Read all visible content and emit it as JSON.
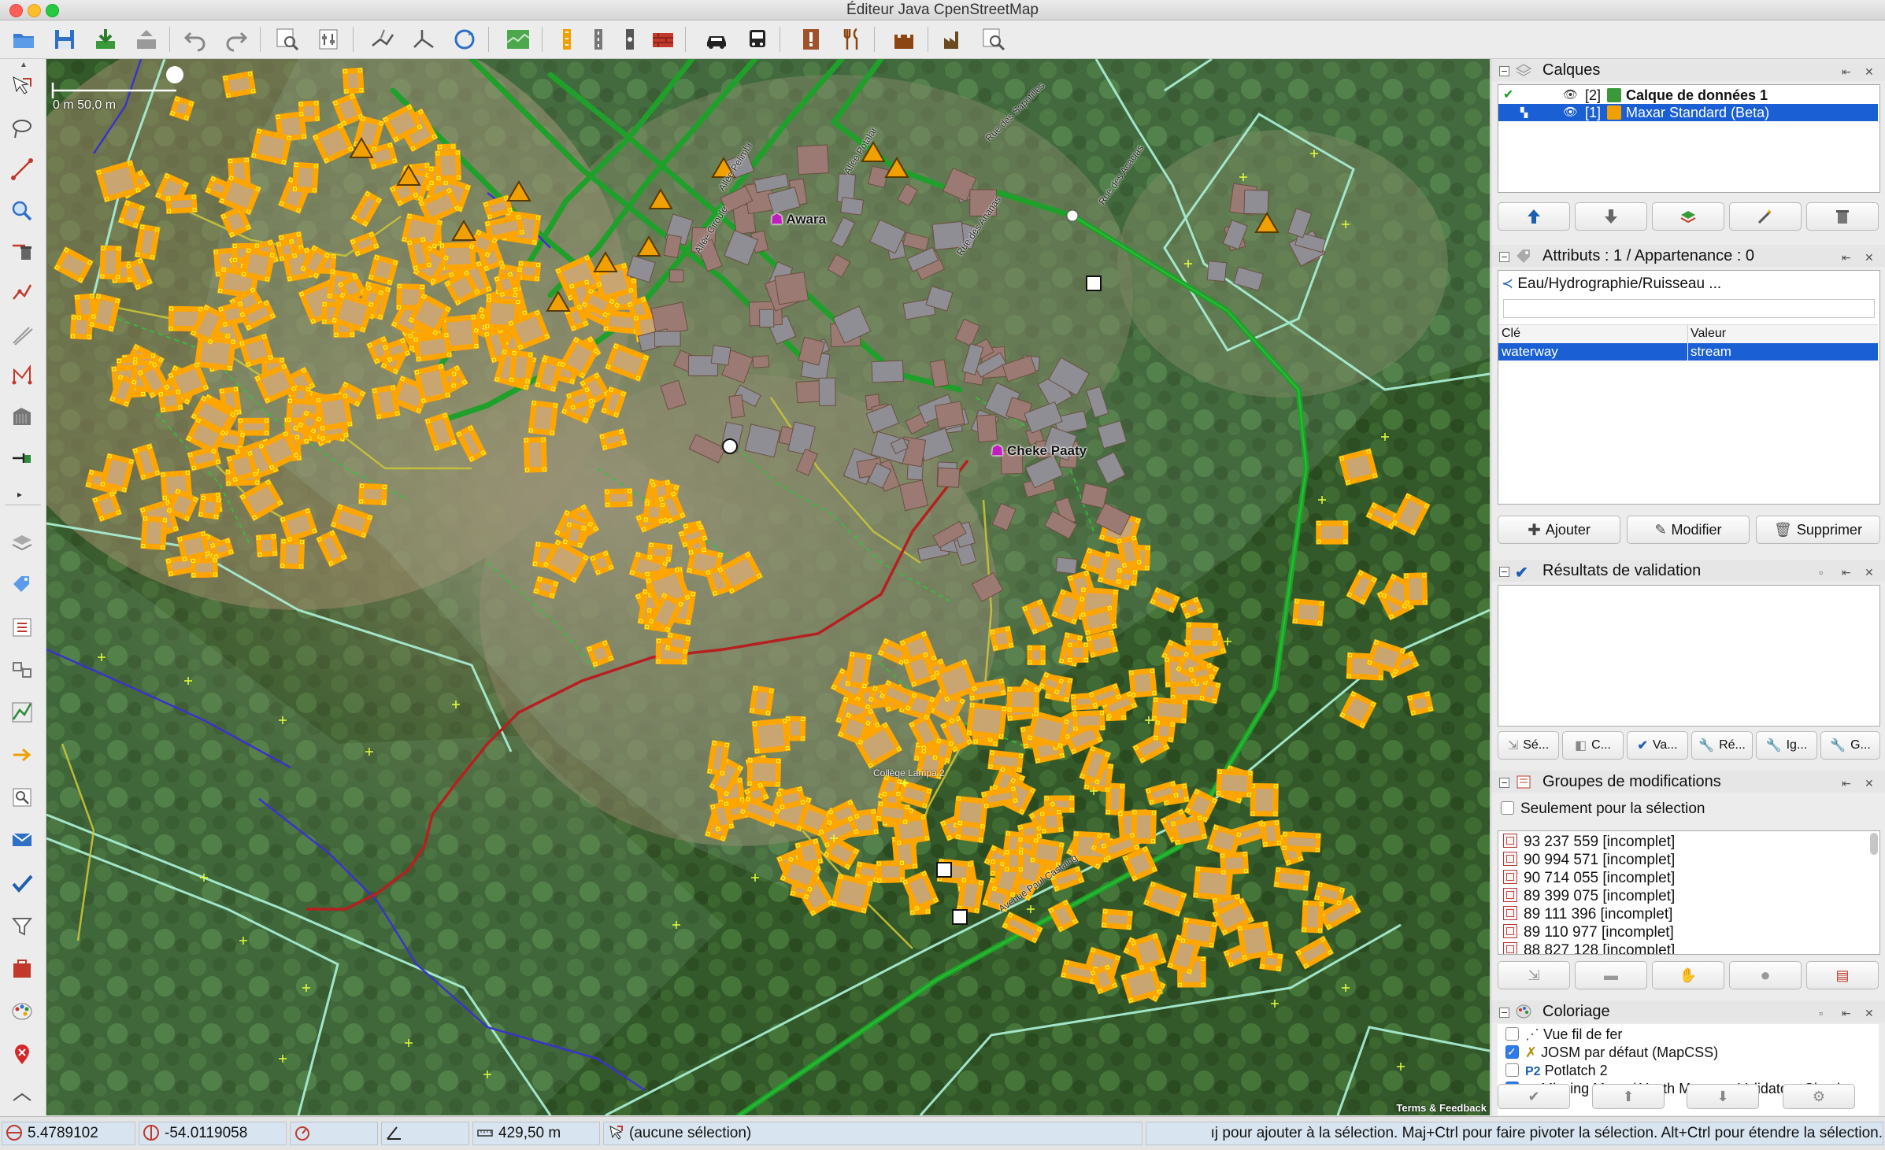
{
  "window": {
    "title": "Éditeur Java CpenStreetMap"
  },
  "map": {
    "scale_label": "0 m          50,0 m",
    "attribution": "Terms & Feedback",
    "place_labels": [
      "Awara",
      "Cheke Paaty"
    ],
    "street_labels": [
      "Allée Pelimbi",
      "Allée Potalai",
      "Rue des Sapotilles",
      "Rue des Acacias",
      "Allée Ciroulé",
      "Allée Ananas",
      "Rue des Ananas",
      "Avenue Paul Castaing",
      "Collège Lampa 2"
    ]
  },
  "layers_panel": {
    "title": "Calques",
    "layers": [
      {
        "index": "[2]",
        "name": "Calque de données 1",
        "active": true,
        "selected": false
      },
      {
        "index": "[1]",
        "name": "Maxar Standard (Beta)",
        "active": false,
        "selected": true
      }
    ]
  },
  "attributes_panel": {
    "title": "Attributs : 1 / Appartenance : 0",
    "preset": "Eau/Hydrographie/Ruisseau ...",
    "col_key": "Clé",
    "col_value": "Valeur",
    "rows": [
      {
        "key": "waterway",
        "value": "stream"
      }
    ],
    "add_label": "Ajouter",
    "edit_label": "Modifier",
    "delete_label": "Supprimer"
  },
  "validation_panel": {
    "title": "Résultats de validation",
    "buttons": [
      "Sé...",
      "C...",
      "Va...",
      "Ré...",
      "Ig...",
      "G..."
    ]
  },
  "changesets_panel": {
    "title": "Groupes de modifications",
    "only_selection_label": "Seulement pour la sélection",
    "items": [
      "93 237 559 [incomplet]",
      "90 994 571 [incomplet]",
      "90 714 055 [incomplet]",
      "89 399 075 [incomplet]",
      "89 111 396 [incomplet]",
      "89 110 977 [incomplet]",
      "88 827 128 [incomplet]"
    ]
  },
  "styles_panel": {
    "title": "Coloriage",
    "items": [
      {
        "label": "Vue fil de fer",
        "checked": false
      },
      {
        "label": "JOSM par défaut (MapCSS)",
        "checked": true
      },
      {
        "label": "Potlatch 2",
        "checked": false,
        "badge": "P2"
      },
      {
        "label": "Missing Maps / Youth Mappers Validators Checks",
        "checked": true
      }
    ]
  },
  "status_bar": {
    "lat": "5.4789102",
    "lon": "-54.0119058",
    "heading": "",
    "angle": "",
    "distance": "429,50 m",
    "selection": "(aucune sélection)",
    "help": "ıj pour ajouter à la sélection. Maj+Ctrl pour faire pivoter la sélection. Alt+Ctrl pour étendre la sélection."
  },
  "colors": {
    "selection_blue": "#1a5fd4",
    "building_orange": "#ffa500",
    "road_green": "#1fa02a",
    "boundary_mint": "#9ee6c8"
  }
}
